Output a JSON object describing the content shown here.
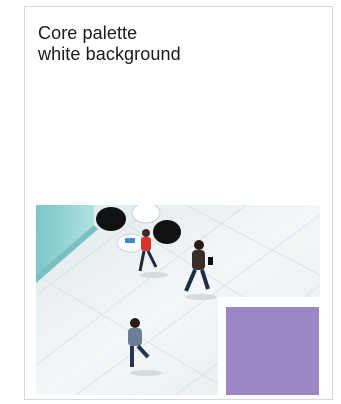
{
  "card": {
    "title_line1": "Core palette",
    "title_line2": "white background"
  },
  "swatch": {
    "color": "#9b87c4"
  },
  "photo": {
    "description_icon": "people-walking-atrium-photo"
  }
}
